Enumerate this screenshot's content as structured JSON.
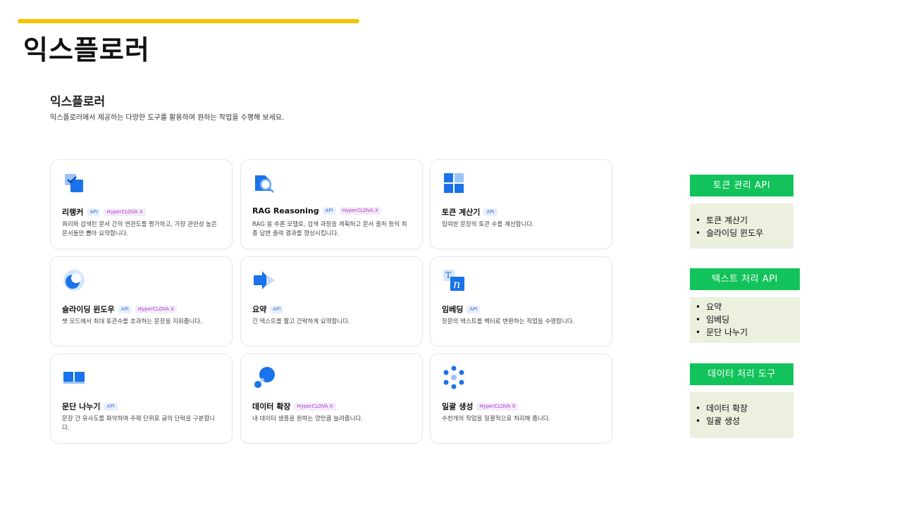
{
  "slide": {
    "title": "익스플로러"
  },
  "section": {
    "title": "익스플로러",
    "description": "익스플로러에서 제공하는 다양한 도구를 활용하여 원하는 작업을 수행해 보세요."
  },
  "badges": {
    "api": "API",
    "hyperclova": "HyperCLOVA X"
  },
  "colors": {
    "accent": "#f5c400",
    "panel_header": "#11c35a",
    "panel_body": "#ebf0df",
    "icon_blue": "#1a73e8"
  },
  "cards": [
    {
      "title": "리랭커",
      "icon": "reranker-icon",
      "api": true,
      "hcx": true,
      "desc": "쿼리와 검색된 문서 간의 연관도를 평가하고, 가장 관련성 높은 문서들만 뽑아 요약합니다."
    },
    {
      "title": "RAG Reasoning",
      "icon": "rag-reasoning-icon",
      "api": true,
      "hcx": true,
      "desc": "RAG 용 추론 모델로, 검색 과정을 계획하고 문서 출처 등의 최종 답변 출력 결과를 향상시킵니다."
    },
    {
      "title": "토큰 계산기",
      "icon": "token-calculator-icon",
      "api": true,
      "hcx": false,
      "desc": "입력한 문장의 토큰 수를 계산합니다."
    },
    {
      "title": "슬라이딩 윈도우",
      "icon": "sliding-window-icon",
      "api": true,
      "hcx": true,
      "desc": "챗 모드에서 최대 토큰수를 초과하는 문장을 지워줍니다."
    },
    {
      "title": "요약",
      "icon": "summary-icon",
      "api": true,
      "hcx": false,
      "desc": "긴 텍스트를 짧고 간략하게 요약합니다."
    },
    {
      "title": "임베딩",
      "icon": "embedding-icon",
      "api": true,
      "hcx": false,
      "desc": "장문의 텍스트를 벡터로 변환하는 작업을 수행합니다."
    },
    {
      "title": "문단 나누기",
      "icon": "paragraph-split-icon",
      "api": true,
      "hcx": false,
      "desc": "문장 간 유사도를 파악하여 주제 단위로 글의 단락을 구분합니다."
    },
    {
      "title": "데이터 확장",
      "icon": "data-augmentation-icon",
      "api": false,
      "hcx": true,
      "desc": "내 데이터 샘플을 원하는 양만큼 늘려줍니다."
    },
    {
      "title": "일괄 생성",
      "icon": "batch-generation-icon",
      "api": false,
      "hcx": true,
      "desc": "수천개의 작업을 일괄적으로 처리해 줍니다."
    }
  ],
  "side_panels": [
    {
      "header": "토큰 관리 API",
      "items": [
        "토큰 계산기",
        "슬라이딩 윈도우"
      ]
    },
    {
      "header": "텍스트 처리 API",
      "items": [
        "요약",
        "임베딩",
        "문단 나누기"
      ]
    },
    {
      "header": "데이터 처리 도구",
      "items": [
        "데이터 확장",
        "일괄 생성"
      ]
    }
  ]
}
